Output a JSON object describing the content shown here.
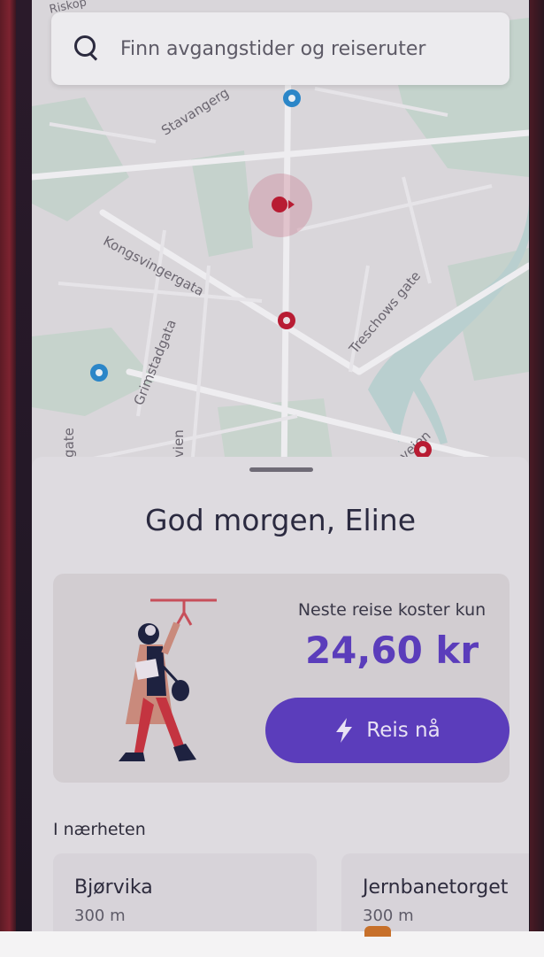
{
  "map": {
    "corner_label": "Riskop",
    "streets": [
      {
        "id": "stavanger",
        "text": "Stavangerg"
      },
      {
        "id": "kongsvinger",
        "text": "Kongsvingergata"
      },
      {
        "id": "grimstad",
        "text": "Grimstadgata"
      },
      {
        "id": "treschows",
        "text": "Treschows gate"
      },
      {
        "id": "gate-left",
        "text": "gate"
      },
      {
        "id": "vien",
        "text": "vien"
      },
      {
        "id": "veien-right",
        "text": "veien"
      }
    ]
  },
  "search": {
    "placeholder": "Finn avgangstider og reiseruter"
  },
  "sheet": {
    "greeting": "God morgen, Eline",
    "promo": {
      "caption": "Neste reise koster kun",
      "price": "24,60 kr",
      "button_label": "Reis nå"
    },
    "nearby_label": "I nærheten",
    "stops": [
      {
        "name": "Bjørvika",
        "distance": "300 m"
      },
      {
        "name": "Jernbanetorget",
        "distance": "300 m"
      }
    ]
  },
  "colors": {
    "accent": "#5b3dbb",
    "pin_red": "#c0203a",
    "pin_blue": "#2b86c8"
  },
  "icons": [
    "search-icon",
    "lightning-icon",
    "location-pin-icon",
    "bus-stop-icon"
  ]
}
